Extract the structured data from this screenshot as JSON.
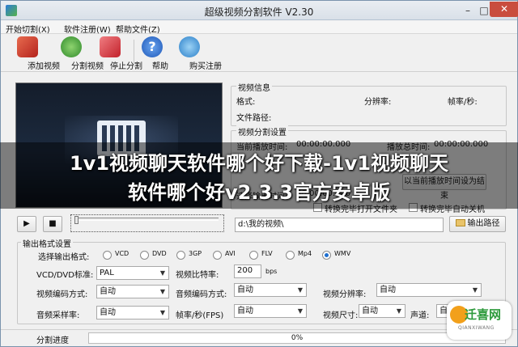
{
  "window": {
    "title": "超级视频分割软件 V2.30"
  },
  "menu": [
    "开始切割(X)",
    "软件注册(W)",
    "帮助文件(Z)"
  ],
  "toolbar": [
    {
      "label": "添加视频",
      "icon": "add-video-icon",
      "color": "#d23b2f"
    },
    {
      "label": "分割视频",
      "icon": "split-video-icon",
      "color": "#3ca83a"
    },
    {
      "label": "停止分割",
      "icon": "stop-split-icon",
      "color": "#d2323b"
    },
    {
      "label": "帮助",
      "icon": "help-icon",
      "color": "#2e6fd0"
    },
    {
      "label": "购买注册",
      "icon": "buy-register-icon",
      "color": "#2a86d6"
    }
  ],
  "video_info": {
    "group": "视频信息",
    "format": "格式:",
    "resolution": "分辨率:",
    "fps": "帧率/秒:",
    "path": "文件路径:"
  },
  "split_settings": {
    "group": "视频分割设置",
    "start_time_label": "当前播放时间:",
    "start_time_value": "00:00:00.000",
    "total_time_label": "播放总时间:",
    "total_time_value": "00:00:00.000",
    "set_end_button": "以当前播放时间设为结束",
    "select_output_label": "选择输出时间:",
    "select_output_value": "00:00:00.000",
    "open_folder_checkbox": "转换完毕打开文件夹",
    "shutdown_checkbox": "转换完毕自动关机",
    "output_path": "d:\\我的视频\\",
    "output_button": "输出路径"
  },
  "output": {
    "group": "输出格式设置",
    "format_label": "选择输出格式:",
    "formats": [
      "VCD",
      "DVD",
      "3GP",
      "AVI",
      "FLV",
      "Mp4",
      "WMV"
    ],
    "selected_format": "WMV",
    "std_label": "VCD/DVD标准:",
    "std_value": "PAL",
    "bitrate_label": "视频比特率:",
    "bitrate_value": "200",
    "bitrate_unit": "bps",
    "vcodec_label": "视频编码方式:",
    "vcodec_value": "自动",
    "acodec_label": "音频编码方式:",
    "acodec_value": "自动",
    "vres_label": "视频分辨率:",
    "vres_value": "自动",
    "asr_label": "音频采样率:",
    "asr_value": "自动",
    "fps_label": "帧率/秒(FPS)",
    "fps_value": "自动",
    "vsize_label": "视频尺寸:",
    "vsize_value": "自动",
    "channel_label": "声道:",
    "channel_value": "自动"
  },
  "status": {
    "label": "分割进度",
    "progress": "0%"
  },
  "overlay": {
    "line1": "1v1视频聊天软件哪个好下载-1v1视频聊天",
    "line2": "软件哪个好v2.3.3官方安卓版"
  },
  "watermark": {
    "text": "迁喜网",
    "sub": "QIANXIWANG"
  }
}
